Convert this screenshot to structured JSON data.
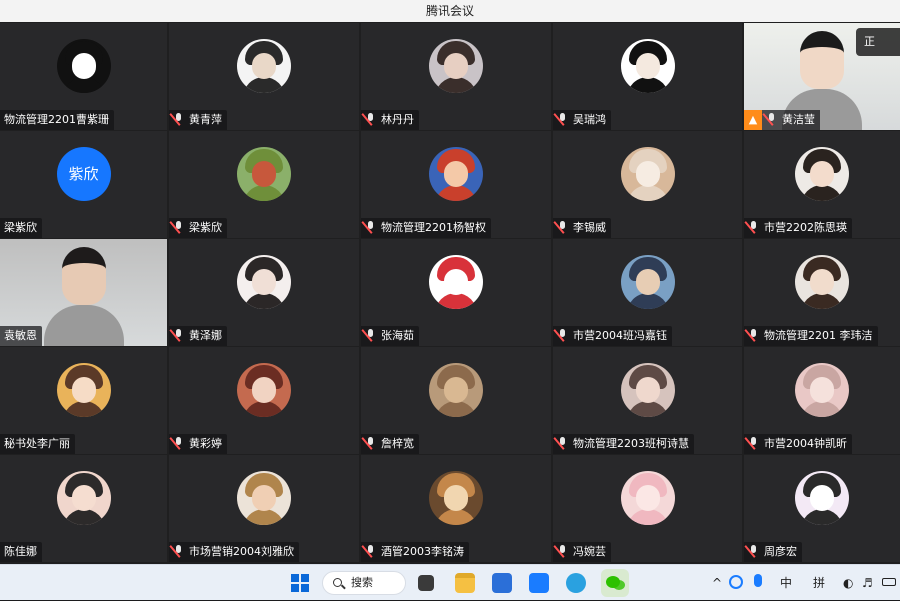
{
  "window": {
    "title": "腾讯会议"
  },
  "participants": [
    {
      "name": "物流管理2201曹紫珊",
      "muted": false,
      "avatar": "sketch",
      "colors": [
        "#111111",
        "#ffffff",
        "#111111"
      ]
    },
    {
      "name": "黄青萍",
      "muted": true,
      "avatar": "photo",
      "colors": [
        "#2a2a2a",
        "#e9d8c8",
        "#f4f4f4"
      ]
    },
    {
      "name": "林丹丹",
      "muted": true,
      "avatar": "photo",
      "colors": [
        "#3a2e2b",
        "#e7cfc2",
        "#c9c3c7"
      ]
    },
    {
      "name": "吴瑞鸿",
      "muted": true,
      "avatar": "cartoon",
      "colors": [
        "#111111",
        "#f4e9df",
        "#ffffff"
      ]
    },
    {
      "name": "黄洁莹",
      "muted": true,
      "avatar": "video",
      "host": true,
      "colors": [
        "#1b1b1b",
        "#f0d8c6",
        "#eef0ec"
      ]
    },
    {
      "name": "梁紫欣",
      "muted": false,
      "avatar": "text",
      "avatar_text": "紫欣",
      "colors": [
        "#1677ff"
      ]
    },
    {
      "name": "梁紫欣",
      "muted": true,
      "avatar": "photo",
      "colors": [
        "#6f8f3a",
        "#c7583c",
        "#8bb06a"
      ]
    },
    {
      "name": "物流管理2201杨智权",
      "muted": true,
      "avatar": "photo",
      "colors": [
        "#c9402c",
        "#f4c9a8",
        "#3a64b8"
      ]
    },
    {
      "name": "李锡威",
      "muted": true,
      "avatar": "photo",
      "colors": [
        "#e4d2c0",
        "#f6ece2",
        "#d8b89a"
      ]
    },
    {
      "name": "市营2202陈思瑛",
      "muted": true,
      "avatar": "photo",
      "colors": [
        "#2a231f",
        "#f3dccc",
        "#eeeae6"
      ]
    },
    {
      "name": "袁敏恩",
      "muted": false,
      "avatar": "video",
      "colors": [
        "#1e1b1b",
        "#e7cab4",
        "#bfbfbf"
      ]
    },
    {
      "name": "黄泽娜",
      "muted": true,
      "avatar": "photo",
      "colors": [
        "#2b2727",
        "#f0dfd6",
        "#f4efee"
      ]
    },
    {
      "name": "张海茹",
      "muted": true,
      "avatar": "cartoon",
      "colors": [
        "#d8323a",
        "#ffffff",
        "#ffffff"
      ]
    },
    {
      "name": "市营2004班冯嘉钰",
      "muted": true,
      "avatar": "photo",
      "colors": [
        "#2f3d56",
        "#e7cdb4",
        "#7aa0c4"
      ]
    },
    {
      "name": "物流管理2201 李玮洁",
      "muted": true,
      "avatar": "photo",
      "colors": [
        "#3a2a22",
        "#f1dccc",
        "#e9e4df"
      ]
    },
    {
      "name": "秘书处李广丽",
      "muted": false,
      "avatar": "cartoon",
      "colors": [
        "#5b3a28",
        "#f6dcc6",
        "#e9b35a"
      ]
    },
    {
      "name": "黄彩婷",
      "muted": true,
      "avatar": "photo",
      "colors": [
        "#6b2d23",
        "#f1d3c2",
        "#c46a4f"
      ]
    },
    {
      "name": "詹梓宽",
      "muted": true,
      "avatar": "photo",
      "colors": [
        "#8c6a4c",
        "#d9b892",
        "#b89a7a"
      ]
    },
    {
      "name": "物流管理2203班柯诗慧",
      "muted": true,
      "avatar": "photo",
      "colors": [
        "#5e4a45",
        "#efd8cd",
        "#d6c3bd"
      ]
    },
    {
      "name": "市营2004钟凯昕",
      "muted": true,
      "avatar": "photo",
      "colors": [
        "#c9a6a2",
        "#f5e1dc",
        "#e9c8c6"
      ]
    },
    {
      "name": "陈佳娜",
      "muted": false,
      "avatar": "cartoon",
      "colors": [
        "#2c2a2a",
        "#f5ddd0",
        "#f0d6cc"
      ]
    },
    {
      "name": "市场营销2004刘雅欣",
      "muted": true,
      "avatar": "photo",
      "colors": [
        "#b0854c",
        "#f0cfb4",
        "#ece3d8"
      ]
    },
    {
      "name": "酒管2003李铭涛",
      "muted": true,
      "avatar": "photo",
      "colors": [
        "#c4874a",
        "#f1d6b0",
        "#6a4a2e"
      ]
    },
    {
      "name": "冯婉芸",
      "muted": true,
      "avatar": "photo",
      "colors": [
        "#f0b8c0",
        "#fbe7e5",
        "#f4d8d8"
      ]
    },
    {
      "name": "周彦宏",
      "muted": true,
      "avatar": "cartoon",
      "colors": [
        "#2a2a2a",
        "#ffffff",
        "#f3e9f5"
      ]
    }
  ],
  "corner_button": {
    "label": "正"
  },
  "taskbar": {
    "search_label": "搜索",
    "ime_lang": "中",
    "ime_mode": "拼",
    "icons": [
      "windows-start-icon",
      "search-icon",
      "task-view-icon",
      "file-explorer-icon",
      "store-icon",
      "meeting-icon",
      "edge-icon",
      "wechat-icon"
    ],
    "colors": {
      "start": "#0a68d8",
      "explorer": "#f5c042",
      "store": "#2b6fd8",
      "meeting": "#1a7cff",
      "edge": "#2aa1e0",
      "wechat": "#2dc100"
    }
  }
}
